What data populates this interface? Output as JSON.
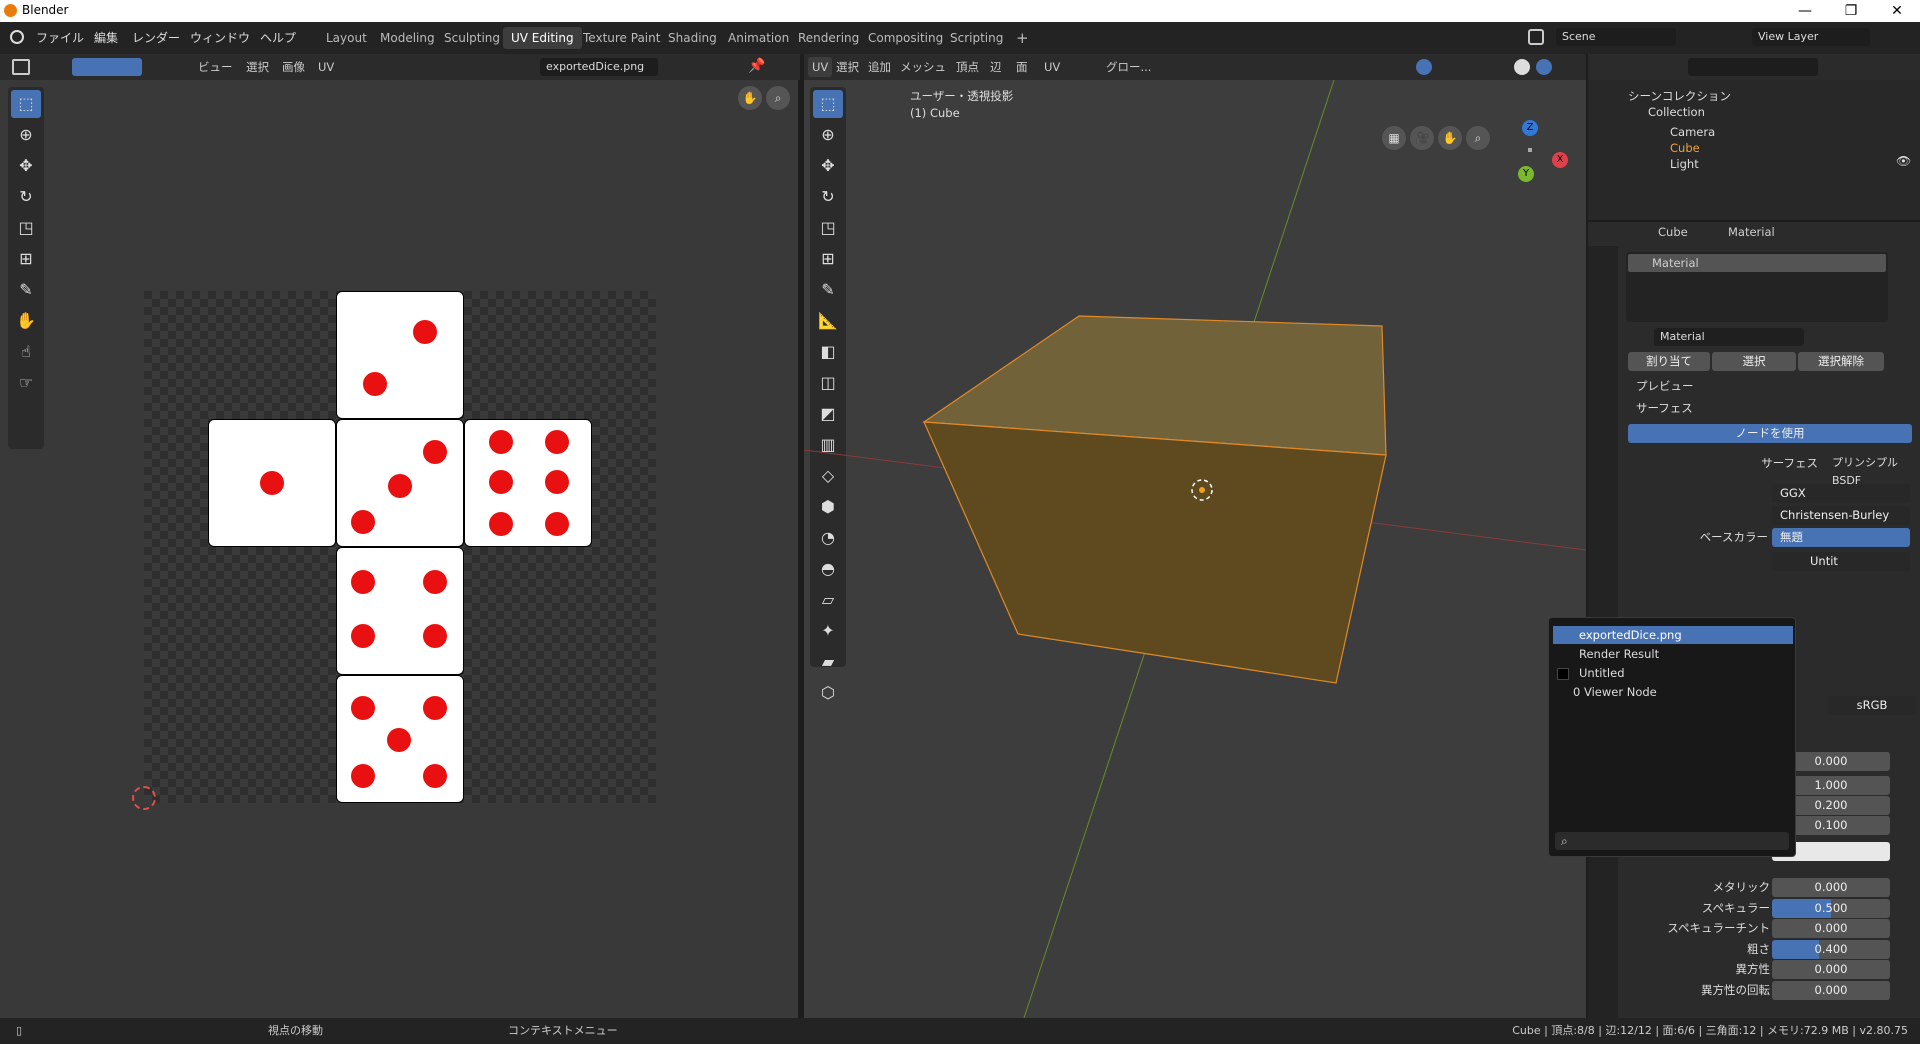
{
  "window": {
    "title": "Blender",
    "minimize": "—",
    "restore": "❐",
    "close": "✕"
  },
  "menu": [
    "ファイル",
    "編集",
    "レンダー",
    "ウィンドウ",
    "ヘルプ"
  ],
  "workspaces": [
    "Layout",
    "Modeling",
    "Sculpting",
    "UV Editing",
    "Texture Paint",
    "Shading",
    "Animation",
    "Rendering",
    "Compositing",
    "Scripting",
    "+"
  ],
  "active_workspace": "UV Editing",
  "scene": {
    "label": "Scene",
    "view_layer": "View Layer"
  },
  "uv_editor": {
    "menus": [
      "ビュー",
      "選択",
      "画像",
      "UV"
    ],
    "image_name": "exportedDice.png"
  },
  "viewport": {
    "mode_label": "UV",
    "menus": [
      "選択",
      "追加",
      "メッシュ",
      "頂点",
      "辺",
      "面",
      "UV"
    ],
    "transform": "グロー...",
    "view_title": "ユーザー・透視投影",
    "object_label": "(1) Cube",
    "axis": {
      "x": "X",
      "y": "Y",
      "z": "Z"
    }
  },
  "outliner": {
    "root": "シーンコレクション",
    "collection": "Collection",
    "items": [
      "Camera",
      "Cube",
      "Light"
    ]
  },
  "properties": {
    "object": "Cube",
    "tab": "Material",
    "slot": "Material",
    "material_name": "Material",
    "assign": "割り当て",
    "select": "選択",
    "deselect": "選択解除",
    "preview": "プレビュー",
    "surface_section": "サーフェス",
    "use_nodes": "ノードを使用",
    "surface_label": "サーフェス",
    "surface_value": "プリンシプルBSDF",
    "distribution": "GGX",
    "subsurface_method": "Christensen-Burley",
    "base_color_label": "ベースカラー",
    "base_color_value": "無題",
    "image_field": "Untit",
    "colorspace": "sRGB",
    "values": [
      "0.000",
      "1.000",
      "0.200",
      "0.100"
    ],
    "rows": [
      {
        "label": "メタリック",
        "value": "0.000",
        "fill": 0
      },
      {
        "label": "スペキュラー",
        "value": "0.500",
        "fill": 0.5
      },
      {
        "label": "スペキュラーチント",
        "value": "0.000",
        "fill": 0
      },
      {
        "label": "粗さ",
        "value": "0.400",
        "fill": 0.4
      },
      {
        "label": "異方性",
        "value": "0.000",
        "fill": 0
      },
      {
        "label": "異方性の回転",
        "value": "0.000",
        "fill": 0
      }
    ]
  },
  "popup": {
    "items": [
      "exportedDice.png",
      "Render Result",
      "Untitled",
      "0 Viewer Node"
    ]
  },
  "status": {
    "left1": "視点の移動",
    "left2": "コンテキストメニュー",
    "right": "Cube | 頂点:8/8 | 辺:12/12 | 面:6/6 | 三角面:12 | メモリ:72.9 MB | v2.80.75"
  }
}
